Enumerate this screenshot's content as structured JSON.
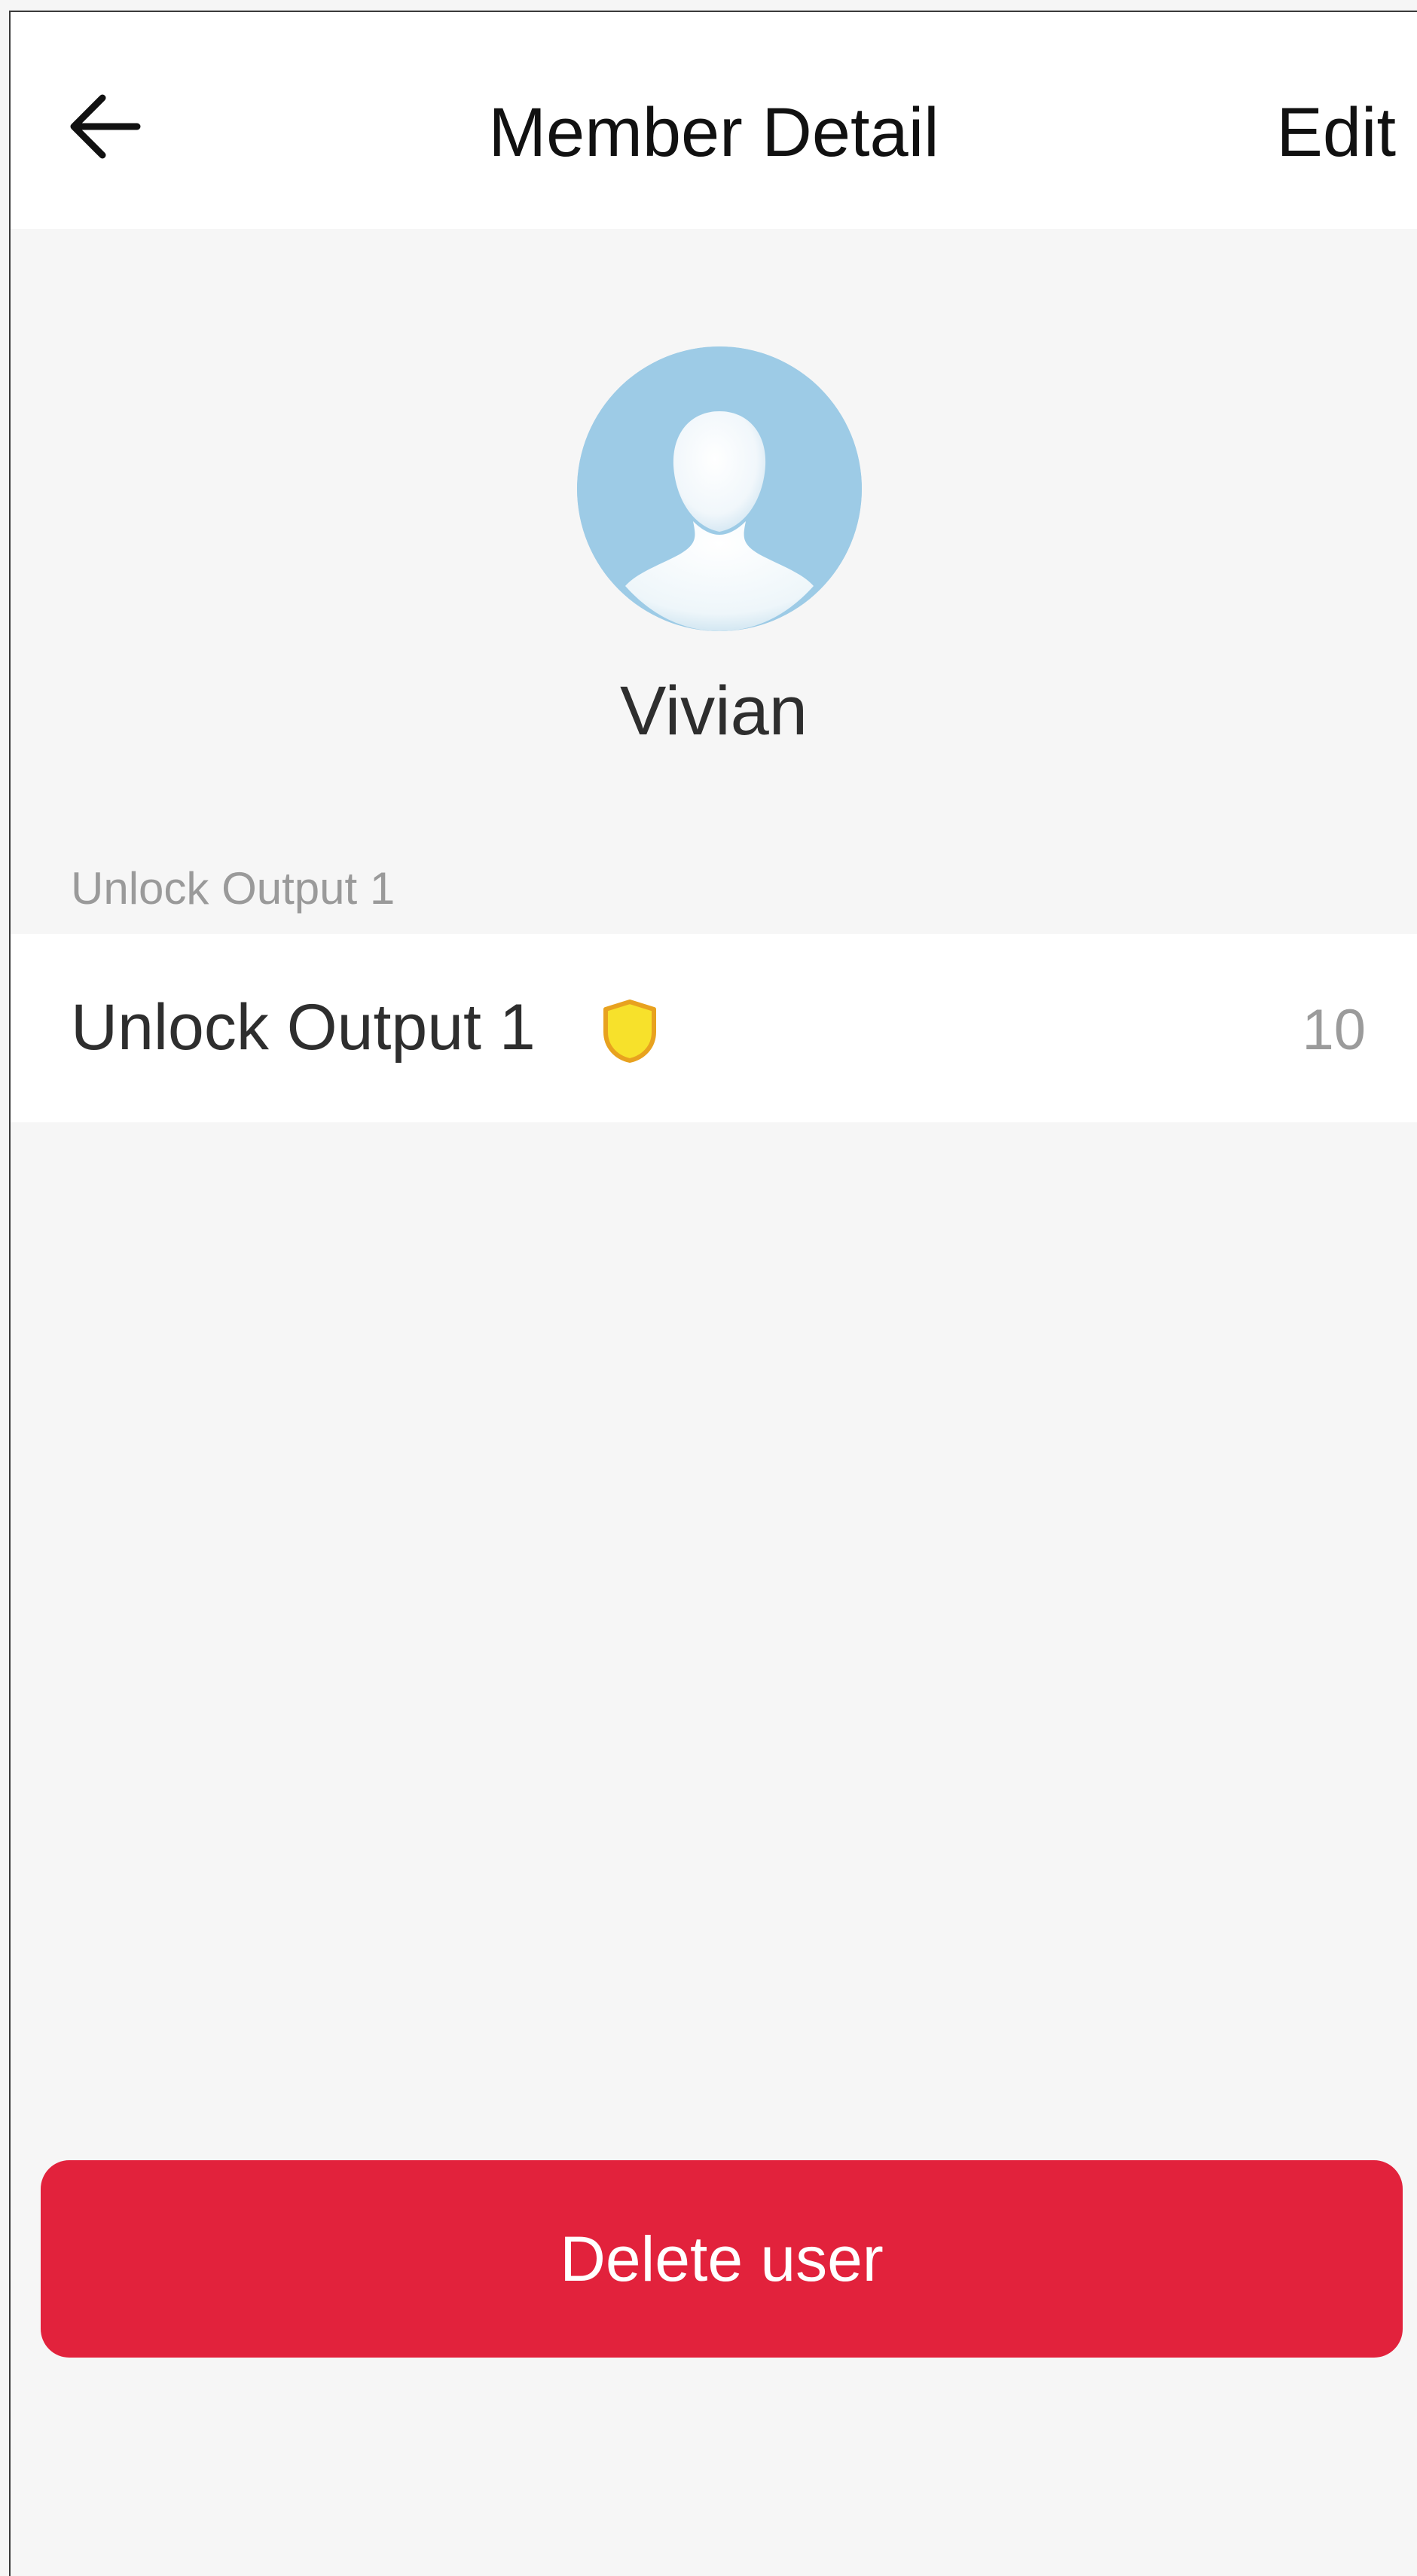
{
  "header": {
    "title": "Member Detail",
    "edit_label": "Edit",
    "back_icon": "arrow-left-icon"
  },
  "member": {
    "name": "Vivian",
    "avatar_icon": "default-user-avatar-icon"
  },
  "unlock_section": {
    "label": "Unlock Output 1",
    "items": [
      {
        "label": "Unlock Output 1",
        "badge_icon": "shield-icon",
        "value": "10"
      }
    ]
  },
  "actions": {
    "delete_label": "Delete user"
  },
  "colors": {
    "background": "#f6f6f6",
    "surface": "#ffffff",
    "danger": "#e2223c",
    "shield_fill": "#f7e12b",
    "shield_stroke": "#e8a21f",
    "avatar_bg": "#9dcbe6"
  }
}
